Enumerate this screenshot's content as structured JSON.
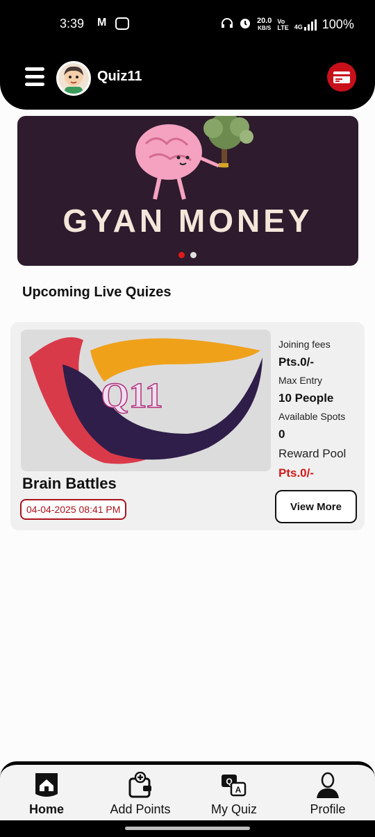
{
  "status_bar": {
    "time": "3:39",
    "carrier_icon": "M",
    "net_speed": "20.0",
    "net_unit": "KB/S",
    "network_label": "4G",
    "battery": "100%"
  },
  "header": {
    "title": "Quiz11",
    "menu_icon": "hamburger-icon",
    "wallet_icon": "card-icon"
  },
  "banner": {
    "text": "GYAN MONEY",
    "slides": 2,
    "active_slide": 0
  },
  "section": {
    "title": "Upcoming Live Quizes"
  },
  "quiz": {
    "logo_text": "Q11",
    "name": "Brain Battles",
    "date": "04-04-2025 08:41 PM",
    "joining_fees_label": "Joining fees",
    "joining_fees_value": "Pts.0/-",
    "max_entry_label": "Max Entry",
    "max_entry_value": "10 People",
    "available_spots_label": "Available Spots",
    "available_spots_value": "0",
    "reward_pool_label": "Reward Pool",
    "reward_pool_value": "Pts.0/-",
    "view_more_label": "View More"
  },
  "bottom_nav": [
    {
      "label": "Home",
      "icon": "home-icon",
      "active": true
    },
    {
      "label": "Add Points",
      "icon": "wallet-add-icon",
      "active": false
    },
    {
      "label": "My Quiz",
      "icon": "qa-icon",
      "active": false
    },
    {
      "label": "Profile",
      "icon": "person-icon",
      "active": false
    }
  ],
  "colors": {
    "header": "#000000",
    "accent": "#c8101a",
    "banner_bg": "#2e1b2d"
  }
}
